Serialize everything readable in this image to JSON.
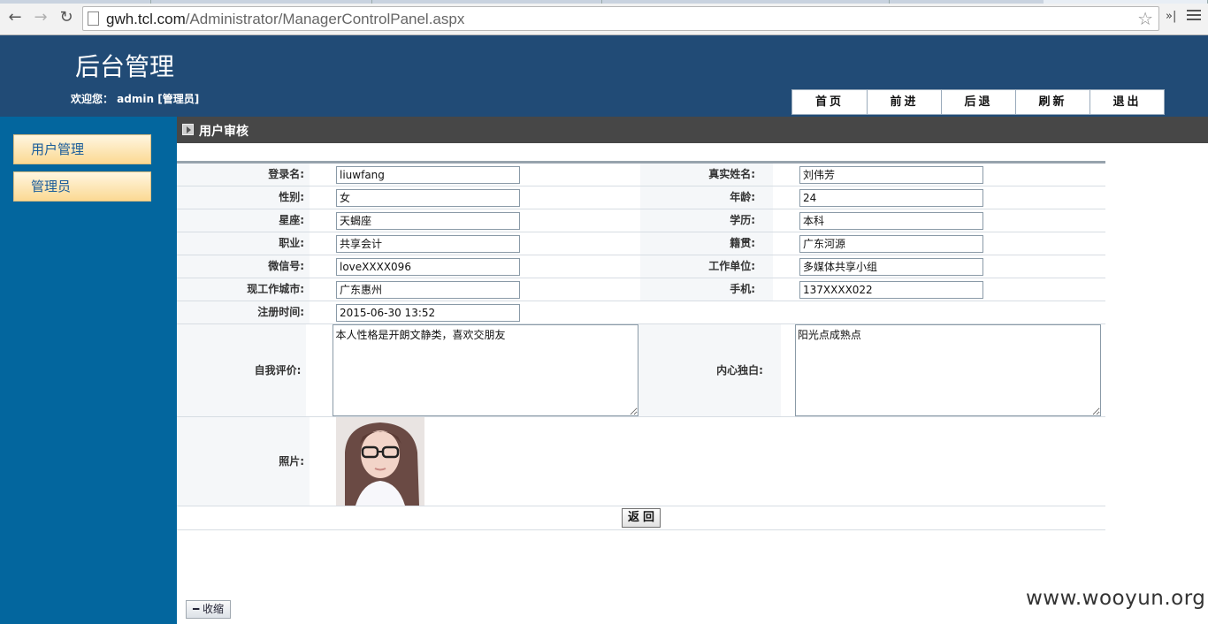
{
  "browser": {
    "url_host": "gwh.tcl.com",
    "url_path": "/Administrator/ManagerControlPanel.aspx"
  },
  "header": {
    "title": "后台管理",
    "welcome": "欢迎您： admin [管理员]",
    "nav": [
      "首页",
      "前进",
      "后退",
      "刷新",
      "退出"
    ]
  },
  "sidebar": {
    "items": [
      "用户管理",
      "管理员"
    ],
    "collapse_label": "收缩"
  },
  "section": {
    "title": "用户审核"
  },
  "form": {
    "login_name_label": "登录名:",
    "login_name": "liuwfang",
    "real_name_label": "真实姓名:",
    "real_name": "刘伟芳",
    "gender_label": "性别:",
    "gender": "女",
    "age_label": "年龄:",
    "age": "24",
    "zodiac_label": "星座:",
    "zodiac": "天蝎座",
    "education_label": "学历:",
    "education": "本科",
    "job_label": "职业:",
    "job": "共享会计",
    "hometown_label": "籍贯:",
    "hometown": "广东河源",
    "wechat_label": "微信号:",
    "wechat": "loveXXXX096",
    "company_label": "工作单位:",
    "company": "多媒体共享小组",
    "city_label": "现工作城市:",
    "city": "广东惠州",
    "phone_label": "手机:",
    "phone": "137XXXX022",
    "reg_time_label": "注册时间:",
    "reg_time": "2015-06-30 13:52",
    "self_eval_label": "自我评价:",
    "self_eval": "本人性格是开朗文静类，喜欢交朋友",
    "monologue_label": "内心独白:",
    "monologue": "阳光点成熟点",
    "photo_label": "照片:",
    "back_label": "返回"
  },
  "watermark": "www.wooyun.org"
}
